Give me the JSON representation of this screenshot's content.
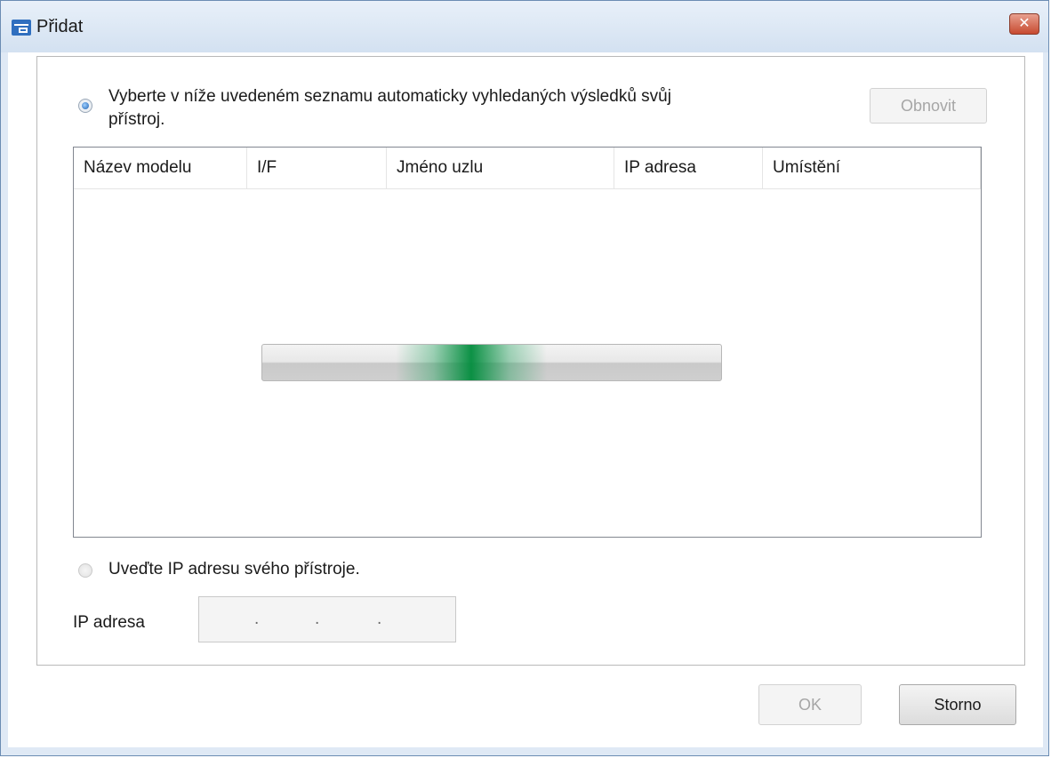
{
  "window": {
    "title": "Přidat",
    "close_symbol": "✕",
    "icon": "device-add-icon"
  },
  "search_section": {
    "radio_label_line1": "Vyberte v níže uvedeném seznamu automaticky vyhledaných výsledků svůj",
    "radio_label_line2": "přístroj.",
    "selected": true,
    "refresh_button": "Obnovit",
    "refresh_enabled": false
  },
  "device_list": {
    "columns": [
      "Název modelu",
      "I/F",
      "Jméno uzlu",
      "IP adresa",
      "Umístění"
    ],
    "rows": [],
    "searching": true
  },
  "manual_section": {
    "radio_label": "Uveďte IP adresu svého přístroje.",
    "selected": false,
    "ip_label": "IP adresa",
    "ip_separators": [
      ".",
      ".",
      "."
    ]
  },
  "footer": {
    "ok_label": "OK",
    "ok_enabled": false,
    "cancel_label": "Storno"
  },
  "colors": {
    "titlebar": "#d9e5f3",
    "progress_accent": "#00873c",
    "close_button": "#c74a30"
  }
}
